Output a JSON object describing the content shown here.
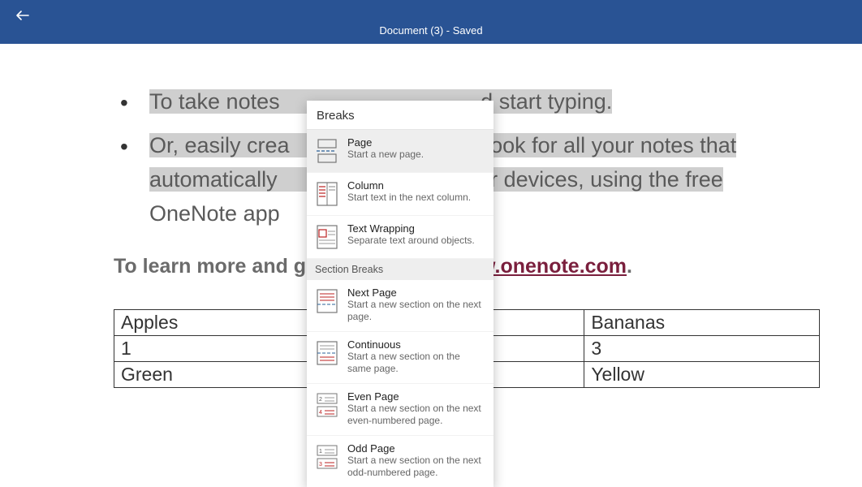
{
  "header": {
    "title": "Document (3) - Saved"
  },
  "bullets": [
    {
      "pre": "To take notes",
      "mid": "                                 ",
      "post": "d start typing."
    },
    {
      "line1_pre": "Or, easily crea",
      "line1_gap": "                                 ",
      "line1_post": "ook for all your notes that",
      "line2_pre": "automatically",
      "line2_gap": "                                   ",
      "line2_post": "r devices, using the free",
      "line3_pre": "OneNote app",
      "line3_gap": ""
    }
  ],
  "learn": {
    "prefix": "To learn more and g",
    "link_text": "ww.onenote.com",
    "suffix": "."
  },
  "table": {
    "rows": [
      [
        "Apples",
        "",
        "Bananas"
      ],
      [
        "1",
        "",
        "3"
      ],
      [
        "Green",
        "",
        "Yellow"
      ]
    ]
  },
  "dropdown": {
    "header": "Breaks",
    "section_label": "Section Breaks",
    "page_items": [
      {
        "icon": "page-icon",
        "title": "Page",
        "desc": "Start a new page.",
        "hovered": true
      },
      {
        "icon": "column-icon",
        "title": "Column",
        "desc": "Start text in the next column."
      },
      {
        "icon": "textwrap-icon",
        "title": "Text Wrapping",
        "desc": "Separate text around objects."
      }
    ],
    "section_items": [
      {
        "icon": "nextpage-icon",
        "title": "Next Page",
        "desc": "Start a new section on the next page."
      },
      {
        "icon": "continuous-icon",
        "title": "Continuous",
        "desc": "Start a new section on the same page."
      },
      {
        "icon": "evenpage-icon",
        "title": "Even Page",
        "desc": "Start a new section on the next even-numbered page."
      },
      {
        "icon": "oddpage-icon",
        "title": "Odd Page",
        "desc": "Start a new section on the next odd-numbered page."
      }
    ]
  }
}
